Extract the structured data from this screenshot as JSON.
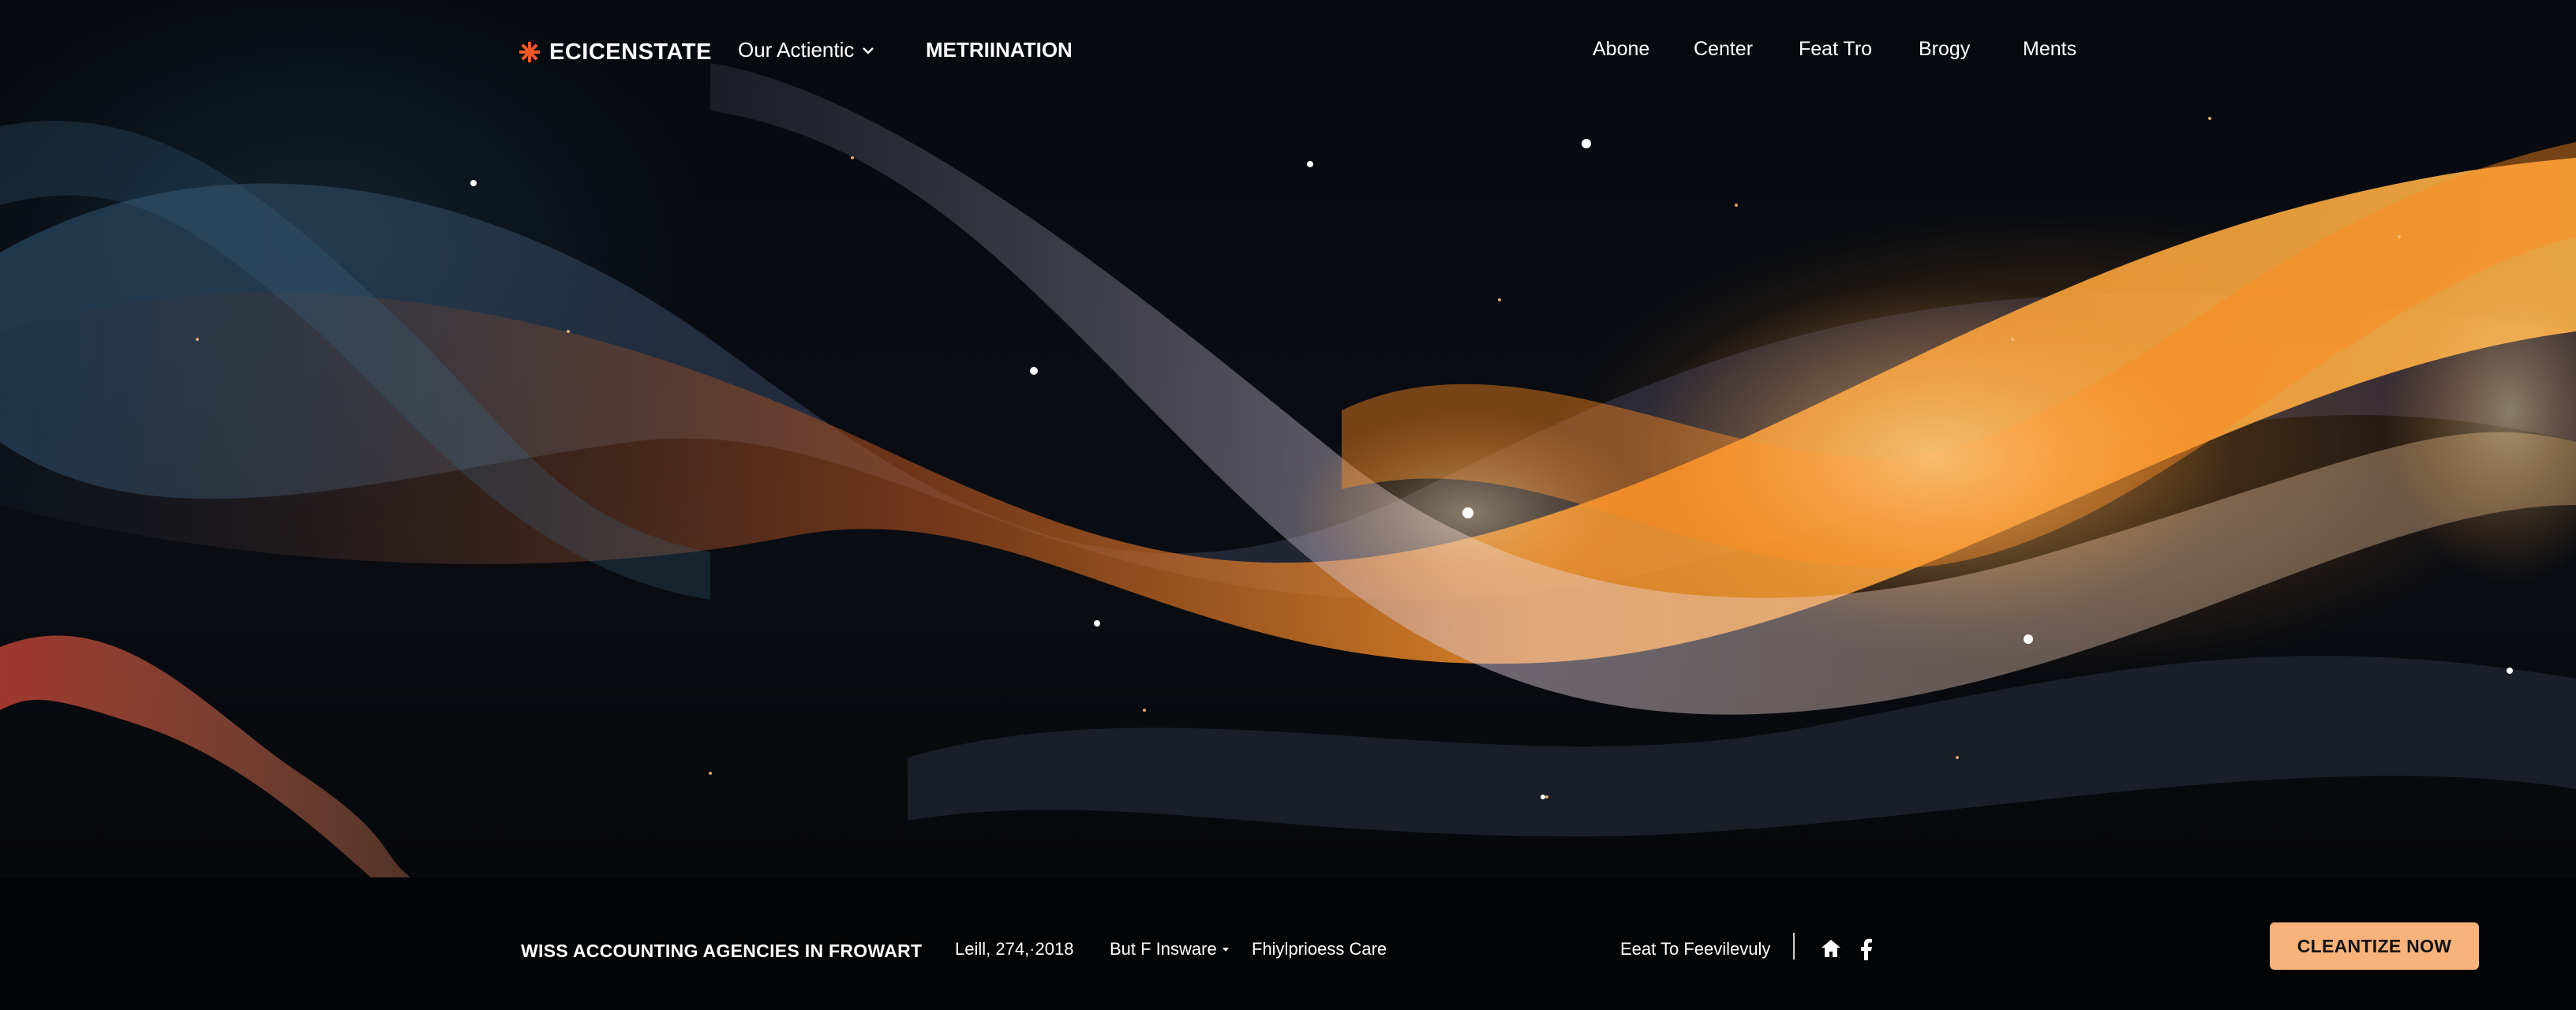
{
  "brand": {
    "name": "ECICENSTATE",
    "accent_color": "#f05a28",
    "icon": "asterisk-logo-icon"
  },
  "nav_left": [
    {
      "label": "Our Actientic",
      "has_dropdown": true,
      "icon": "chevron-down-icon"
    },
    {
      "label": "METRIINATION",
      "has_dropdown": false
    }
  ],
  "nav_right": [
    "Abone",
    "Center",
    "Feat Tro",
    "Brogy",
    "Ments"
  ],
  "footer": {
    "tagline": "WISS ACCOUNTING AGENCIES IN FROWART",
    "date": "Leill, 274,·2018",
    "dropdown_label": "But F Insware",
    "care_link": "Fhiylprioess Care",
    "feat_link": "Eeat To Feevilevuly",
    "icons": [
      "home-icon",
      "facebook-icon"
    ],
    "cta_label": "CLEANTIZE NOW",
    "cta_color": "#f8b27a"
  },
  "colors": {
    "background": "#05070b",
    "bar": "#030405",
    "glow_orange": "#ff9a2e",
    "wave_blue": "#2a4a63"
  }
}
